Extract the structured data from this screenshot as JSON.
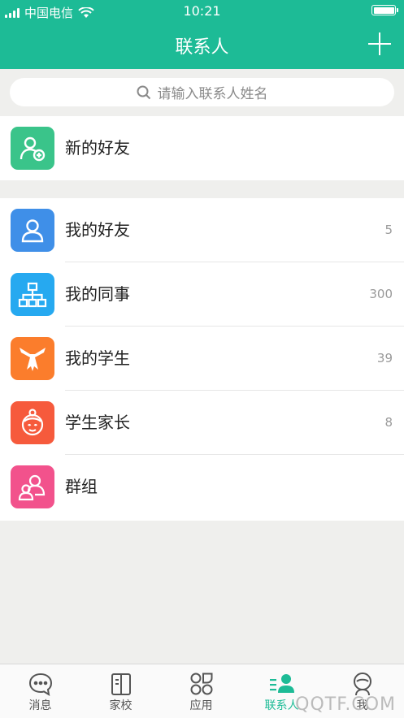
{
  "status_bar": {
    "carrier": "中国电信",
    "time": "10:21"
  },
  "header": {
    "title": "联系人"
  },
  "search": {
    "placeholder": "请输入联系人姓名"
  },
  "new_friends": {
    "label": "新的好友",
    "color": "#3ac48a"
  },
  "contacts": [
    {
      "label": "我的好友",
      "count": "5",
      "icon": "person-icon",
      "color": "#3f8fe8"
    },
    {
      "label": "我的同事",
      "count": "300",
      "icon": "org-chart-icon",
      "color": "#26a9f0"
    },
    {
      "label": "我的学生",
      "count": "39",
      "icon": "scarf-icon",
      "color": "#fb7d2c"
    },
    {
      "label": "学生家长",
      "count": "8",
      "icon": "parent-face-icon",
      "color": "#f65a3c"
    },
    {
      "label": "群组",
      "count": "",
      "icon": "group-icon",
      "color": "#f2528c"
    }
  ],
  "tabs": [
    {
      "label": "消息",
      "icon": "chat-bubble-icon"
    },
    {
      "label": "家校",
      "icon": "book-icon"
    },
    {
      "label": "应用",
      "icon": "apps-icon"
    },
    {
      "label": "联系人",
      "icon": "contacts-icon",
      "active": true
    },
    {
      "label": "我",
      "icon": "profile-icon"
    }
  ],
  "watermark": "QQTF.COM",
  "accent_color": "#1dbb96"
}
